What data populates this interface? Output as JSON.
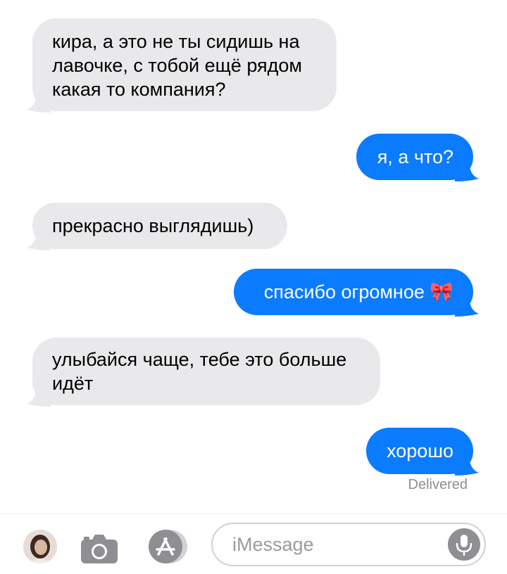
{
  "conversation": {
    "messages": [
      {
        "direction": "incoming",
        "text": "кира, а это не ты сидишь на\nлавочке, с тобой ещё рядом\nкакая то компания?"
      },
      {
        "direction": "outgoing",
        "text": "я, а что?"
      },
      {
        "direction": "incoming",
        "text": "прекрасно выглядишь)"
      },
      {
        "direction": "outgoing",
        "text": "спасибо огромное 🎀"
      },
      {
        "direction": "incoming",
        "text": "улыбайся чаще, тебе это больше\nидёт"
      },
      {
        "direction": "outgoing",
        "text": "хорошо"
      }
    ],
    "status": "Delivered"
  },
  "composer": {
    "placeholder": "iMessage",
    "icons": [
      "avatar",
      "camera-icon",
      "app-store-icon",
      "microphone-icon"
    ]
  },
  "colors": {
    "incoming_bubble": "#e9e9eb",
    "outgoing_bubble": "#0b7bff",
    "status_text": "#8e8e93"
  }
}
